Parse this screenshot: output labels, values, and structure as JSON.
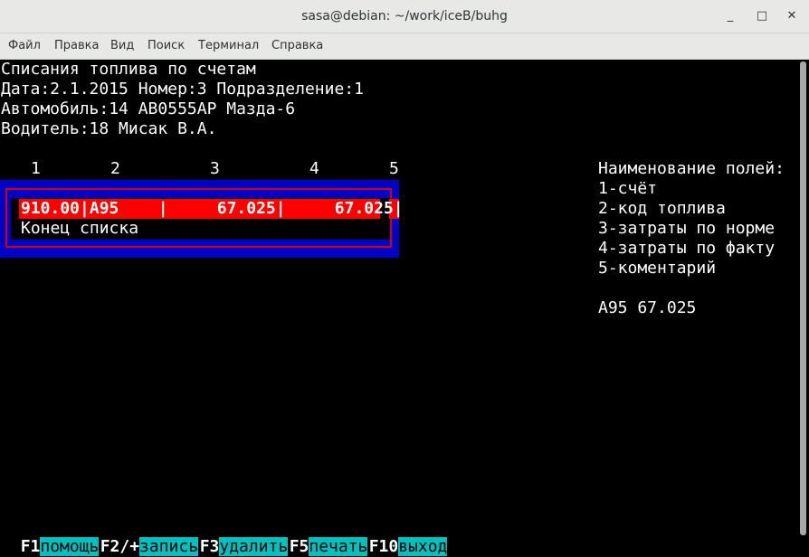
{
  "window": {
    "title": "sasa@debian: ~/work/iceB/buhg",
    "minimize": "_",
    "maximize": "□",
    "close": "✕"
  },
  "menu": [
    "Файл",
    "Правка",
    "Вид",
    "Поиск",
    "Терминал",
    "Справка"
  ],
  "header": {
    "line1": "Списания топлива по счетам",
    "line2": "Дата:2.1.2015 Номер:3 Подразделение:1",
    "line3": "Автомобиль:14 АВ0555АР Мазда-6",
    "line4": "Водитель:18 Мисак В.А."
  },
  "columns": [
    "1",
    "2",
    "3",
    "4",
    "5"
  ],
  "table": {
    "row": "910.00|А95    |     67.025|     67.025|",
    "end": "Конец списка"
  },
  "legend": {
    "title": "Наименование полей:",
    "items": [
      "1-счёт",
      "2-код топлива",
      "3-затраты по норме",
      "4-затраты по факту",
      "5-коментарий"
    ],
    "summary": "А95 67.025"
  },
  "fkeys": [
    {
      "key": "F1",
      "label": "помощь"
    },
    {
      "key": "F2/+",
      "label": "запись"
    },
    {
      "key": "F3",
      "label": "удалить"
    },
    {
      "key": "F5",
      "label": "печать"
    },
    {
      "key": "F10",
      "label": "выход"
    }
  ],
  "colors": {
    "selected_row": "#ff0000",
    "frame": "#0000c8",
    "fkey_label_bg": "#00c0c0"
  }
}
